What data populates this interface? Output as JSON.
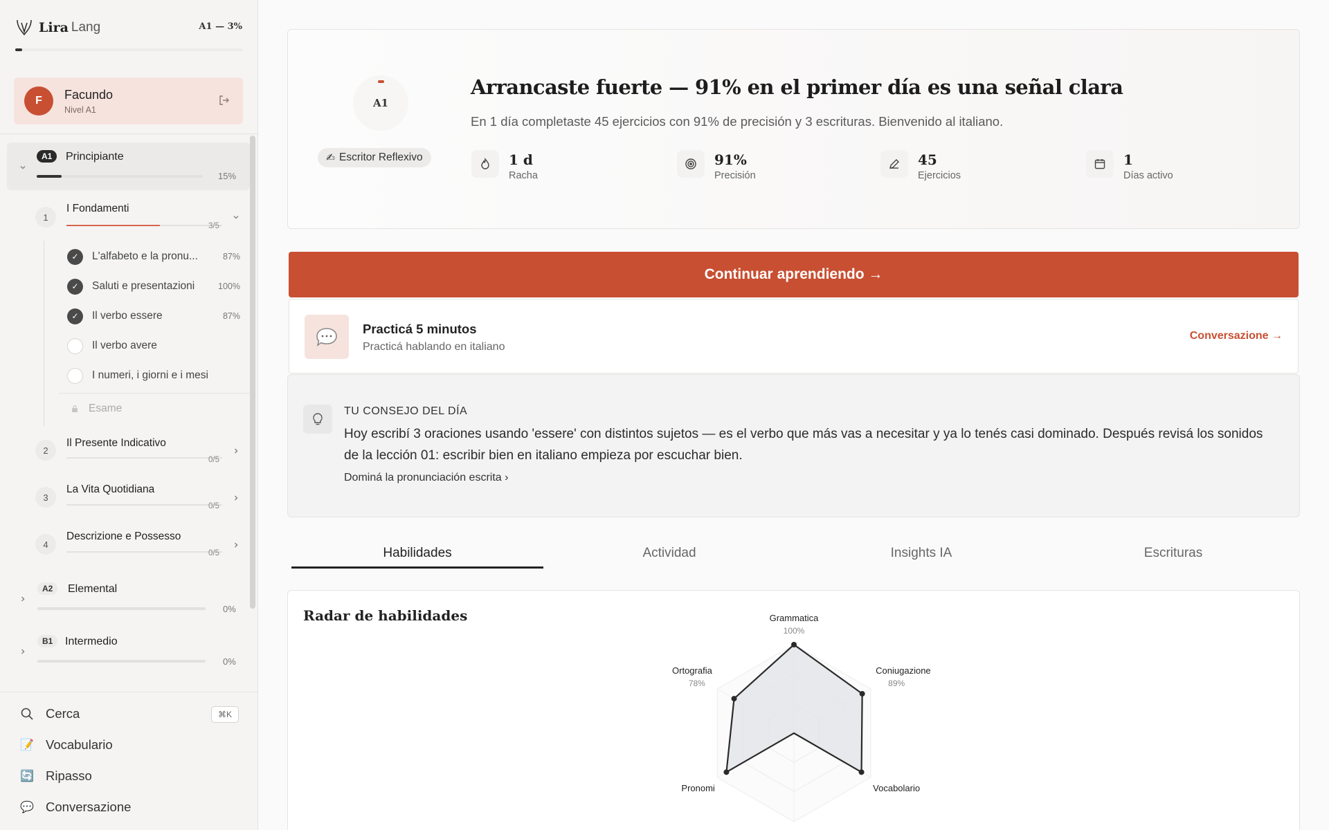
{
  "brand": {
    "name_bold": "Lira",
    "name_light": "Lang",
    "level_progress": "A1 — 3%",
    "progress_fraction": 0.03
  },
  "user": {
    "initial": "F",
    "name": "Facundo",
    "level": "Nivel A1"
  },
  "levels": [
    {
      "code": "A1",
      "title": "Principiante",
      "pct": "15%",
      "fraction": 0.15,
      "expanded": true
    },
    {
      "code": "A2",
      "title": "Elemental",
      "pct": "0%",
      "fraction": 0
    },
    {
      "code": "B1",
      "title": "Intermedio",
      "pct": "0%",
      "fraction": 0
    }
  ],
  "units": [
    {
      "num": "1",
      "title": "I Fondamenti",
      "count": "3/5",
      "fraction": 0.6
    },
    {
      "num": "2",
      "title": "Il Presente Indicativo",
      "count": "0/5",
      "fraction": 0
    },
    {
      "num": "3",
      "title": "La Vita Quotidiana",
      "count": "0/5",
      "fraction": 0
    },
    {
      "num": "4",
      "title": "Descrizione e Possesso",
      "count": "0/5",
      "fraction": 0
    }
  ],
  "lessons": [
    {
      "label": "L'alfabeto e la pronu...",
      "pct": "87%",
      "done": true
    },
    {
      "label": "Saluti e presentazioni",
      "pct": "100%",
      "done": true
    },
    {
      "label": "Il verbo essere",
      "pct": "87%",
      "done": true
    },
    {
      "label": "Il verbo avere",
      "pct": "",
      "done": false
    },
    {
      "label": "I numeri, i giorni e i mesi",
      "pct": "",
      "done": false
    }
  ],
  "exam_label": "Esame",
  "bottom_nav": {
    "search": "Cerca",
    "search_shortcut": "⌘K",
    "vocab": "Vocabulario",
    "review": "Ripasso",
    "conversation": "Conversazione"
  },
  "hero": {
    "ring_label": "A1",
    "badge": "Escritor Reflexivo",
    "title": "Arrancaste fuerte — 91% en el primer día es una señal clara",
    "subtitle": "En 1 día completaste 45 ejercicios con 91% de precisión y 3 escrituras. Bienvenido al italiano.",
    "stats": [
      {
        "value": "1 d",
        "label": "Racha",
        "icon": "flame-icon"
      },
      {
        "value": "91%",
        "label": "Precisión",
        "icon": "target-icon"
      },
      {
        "value": "45",
        "label": "Ejercicios",
        "icon": "pencil-icon"
      },
      {
        "value": "1",
        "label": "Días activo",
        "icon": "calendar-icon"
      }
    ]
  },
  "cta": {
    "label": "Continuar aprendiendo →"
  },
  "practice": {
    "title": "Practicá 5 minutos",
    "subtitle": "Practicá hablando en italiano",
    "link": "Conversazione →"
  },
  "tip": {
    "heading": "TU CONSEJO DEL DÍA",
    "body": "Hoy escribí 3 oraciones usando 'essere' con distintos sujetos — es el verbo que más vas a necesitar y ya lo tenés casi dominado. Después revisá los sonidos de la lección 01: escribir bien en italiano empieza por escuchar bien.",
    "link": "Dominá la pronunciación escrita"
  },
  "tabs": [
    {
      "label": "Habilidades",
      "active": true
    },
    {
      "label": "Actividad",
      "active": false
    },
    {
      "label": "Insights IA",
      "active": false
    },
    {
      "label": "Escrituras",
      "active": false
    }
  ],
  "chart_data": {
    "type": "radar",
    "title": "Radar de habilidades",
    "axes": [
      {
        "name": "Grammatica",
        "value": 100,
        "label": "100%"
      },
      {
        "name": "Coniugazione",
        "value": 89,
        "label": "89%"
      },
      {
        "name": "Vocabolario",
        "value": 88,
        "label": ""
      },
      {
        "name": "",
        "value": 0,
        "label": ""
      },
      {
        "name": "Pronomi",
        "value": 88,
        "label": ""
      },
      {
        "name": "Ortografia",
        "value": 78,
        "label": "78%"
      }
    ],
    "range": [
      0,
      100
    ],
    "grid": true
  }
}
